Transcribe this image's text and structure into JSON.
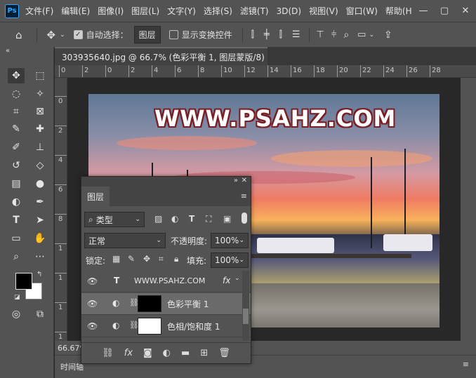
{
  "app": {
    "logo": "Ps"
  },
  "menu": [
    "文件(F)",
    "编辑(E)",
    "图像(I)",
    "图层(L)",
    "文字(Y)",
    "选择(S)",
    "滤镜(T)",
    "3D(D)",
    "视图(V)",
    "窗口(W)",
    "帮助(H"
  ],
  "window_controls": {
    "minimize": "—",
    "maximize": "▢",
    "close": "✕"
  },
  "options": {
    "auto_select_label": "自动选择：",
    "auto_select_checked": "✓",
    "auto_select_target": "图层",
    "show_transform_label": "显示变换控件"
  },
  "document": {
    "tab_title": "303935640.jpg @ 66.7% (色彩平衡 1, 图层蒙版/8) *",
    "close": "×",
    "watermark_text": "WWW.PSAHZ.COM",
    "zoom_status": "66.67%"
  },
  "ruler_top": [
    "0",
    "2",
    "0",
    "2",
    "4",
    "6",
    "8",
    "10",
    "12",
    "14",
    "16",
    "18",
    "20",
    "22",
    "24",
    "26",
    "28"
  ],
  "ruler_left": [
    "0",
    "2",
    "4",
    "6",
    "8",
    "1",
    "1",
    "1",
    "1"
  ],
  "layers_panel": {
    "tab": "图层",
    "filter_kind": "类型",
    "blend_mode": "正常",
    "opacity_label": "不透明度:",
    "opacity_value": "100%",
    "lock_label": "锁定:",
    "fill_label": "填充:",
    "fill_value": "100%",
    "layers": [
      {
        "name": "WWW.PSAHZ.COM",
        "type_glyph": "T",
        "fx": "fx"
      },
      {
        "name": "色彩平衡 1"
      },
      {
        "name": "色相/饱和度 1"
      }
    ]
  },
  "bottom_panel": {
    "tab": "时间轴"
  }
}
